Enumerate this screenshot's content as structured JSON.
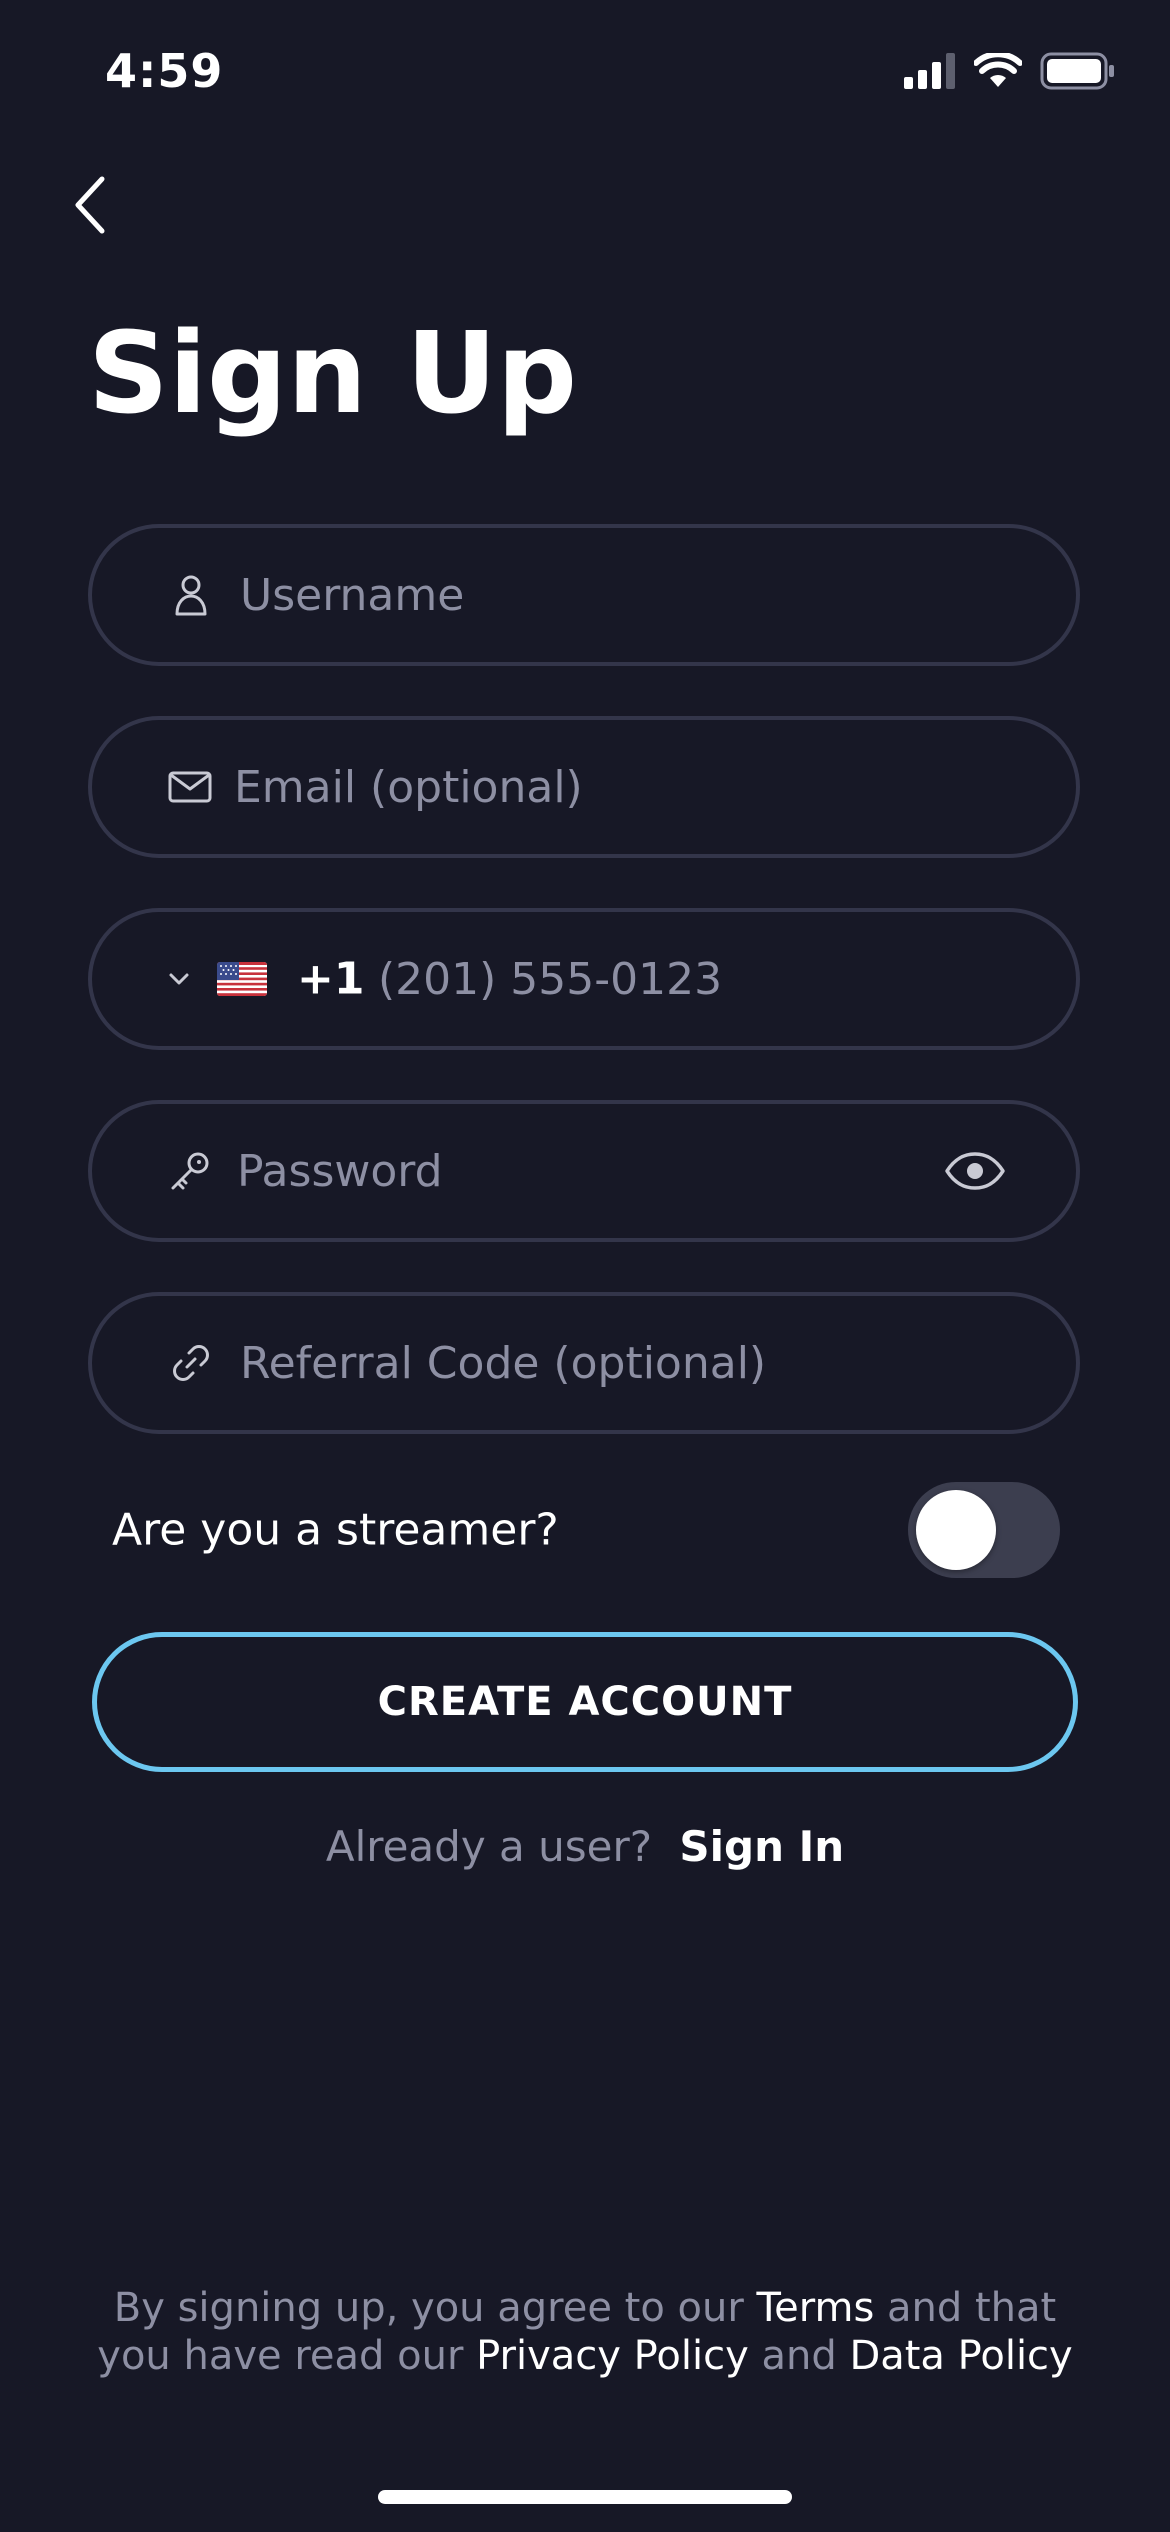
{
  "status_bar": {
    "time": "4:59"
  },
  "header": {
    "title": "Sign Up"
  },
  "form": {
    "username_placeholder": "Username",
    "email_placeholder": "Email (optional)",
    "phone_country_code": "+1",
    "phone_placeholder": "(201) 555-0123",
    "password_placeholder": "Password",
    "referral_placeholder": "Referral Code (optional)",
    "streamer_label": "Are you a streamer?",
    "streamer_enabled": false,
    "create_button_label": "CREATE ACCOUNT"
  },
  "signin": {
    "prompt": "Already a user?",
    "link": "Sign In"
  },
  "legal": {
    "part1": "By signing up, you agree to our ",
    "terms": "Terms",
    "part2": " and that",
    "part3": "you have read our ",
    "privacy": "Privacy Policy",
    "part4": " and ",
    "data_policy": "Data Policy"
  },
  "icons": {
    "back": "chevron-left-icon",
    "username": "person-icon",
    "email": "envelope-icon",
    "country": "chevron-down-icon",
    "password": "key-icon",
    "show_password": "eye-icon",
    "referral": "link-icon"
  },
  "colors": {
    "background": "#171826",
    "field_border": "#33354a",
    "placeholder": "#8d8fa3",
    "accent": "#6cc7f0",
    "toggle_off": "#3c3e4f"
  }
}
